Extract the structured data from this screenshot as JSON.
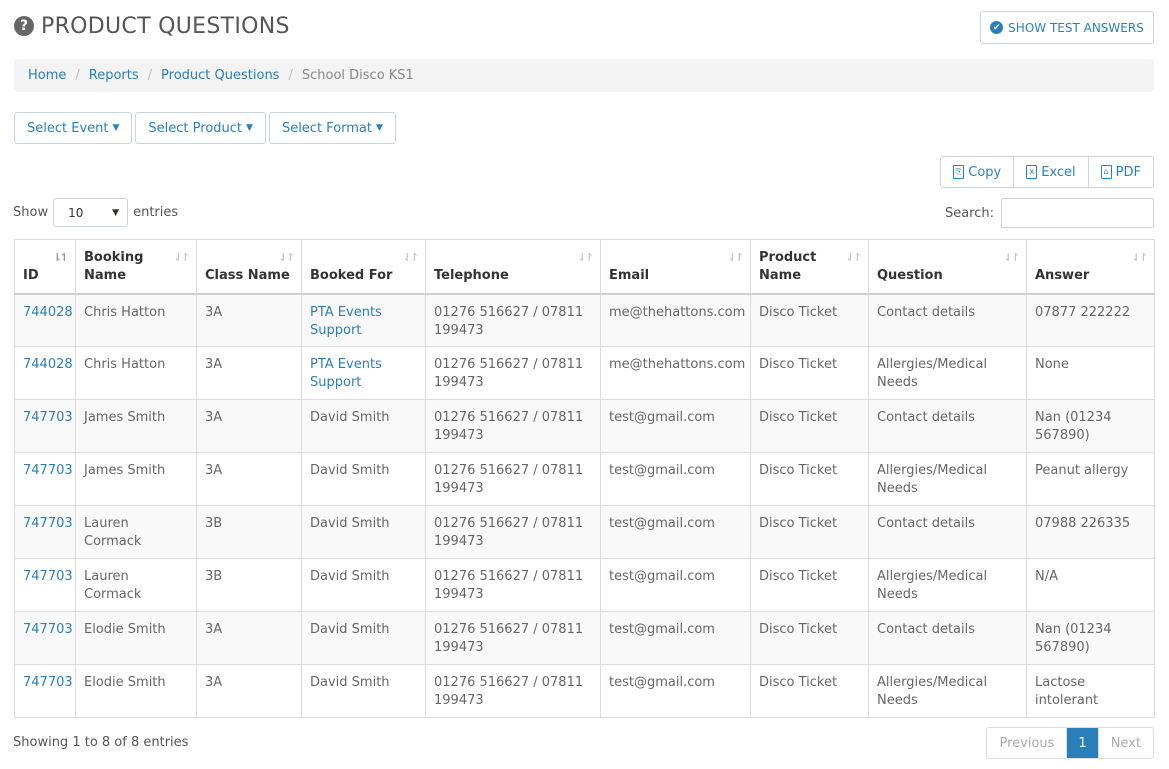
{
  "header": {
    "title": "PRODUCT QUESTIONS",
    "show_answers_label": "SHOW TEST ANSWERS"
  },
  "breadcrumb": {
    "items": [
      "Home",
      "Reports",
      "Product Questions"
    ],
    "current": "School Disco KS1"
  },
  "filters": {
    "event": "Select Event",
    "product": "Select Product",
    "format": "Select Format"
  },
  "export": {
    "copy": "Copy",
    "excel": "Excel",
    "pdf": "PDF"
  },
  "length": {
    "show": "Show",
    "value": "10",
    "entries": "entries"
  },
  "search": {
    "label": "Search:",
    "value": ""
  },
  "table": {
    "columns": [
      "ID",
      "Booking Name",
      "Class Name",
      "Booked For",
      "Telephone",
      "Email",
      "Product Name",
      "Question",
      "Answer"
    ],
    "rows": [
      [
        "744028",
        "Chris Hatton",
        "3A",
        "PTA Events Support",
        "01276 516627 / 07811 199473",
        "me@thehattons.com",
        "Disco Ticket",
        "Contact details",
        "07877 222222"
      ],
      [
        "744028",
        "Chris Hatton",
        "3A",
        "PTA Events Support",
        "01276 516627 / 07811 199473",
        "me@thehattons.com",
        "Disco Ticket",
        "Allergies/Medical Needs",
        "None"
      ],
      [
        "747703",
        "James Smith",
        "3A",
        "David Smith",
        "01276 516627 / 07811 199473",
        "test@gmail.com",
        "Disco Ticket",
        "Contact details",
        "Nan (01234 567890)"
      ],
      [
        "747703",
        "James Smith",
        "3A",
        "David Smith",
        "01276 516627 / 07811 199473",
        "test@gmail.com",
        "Disco Ticket",
        "Allergies/Medical Needs",
        "Peanut allergy"
      ],
      [
        "747703",
        "Lauren Cormack",
        "3B",
        "David Smith",
        "01276 516627 / 07811 199473",
        "test@gmail.com",
        "Disco Ticket",
        "Contact details",
        "07988 226335"
      ],
      [
        "747703",
        "Lauren Cormack",
        "3B",
        "David Smith",
        "01276 516627 / 07811 199473",
        "test@gmail.com",
        "Disco Ticket",
        "Allergies/Medical Needs",
        "N/A"
      ],
      [
        "747703",
        "Elodie Smith",
        "3A",
        "David Smith",
        "01276 516627 / 07811 199473",
        "test@gmail.com",
        "Disco Ticket",
        "Contact details",
        "Nan (01234 567890)"
      ],
      [
        "747703",
        "Elodie Smith",
        "3A",
        "David Smith",
        "01276 516627 / 07811 199473",
        "test@gmail.com",
        "Disco Ticket",
        "Allergies/Medical Needs",
        "Lactose intolerant"
      ]
    ],
    "linked_booked_for": "PTA Events Support"
  },
  "footer": {
    "info": "Showing 1 to 8 of 8 entries",
    "previous": "Previous",
    "page": "1",
    "next": "Next"
  },
  "colors": {
    "accent": "#2a7fba",
    "text": "#555555",
    "border": "#dddddd",
    "stripe": "#f9f9f9"
  }
}
